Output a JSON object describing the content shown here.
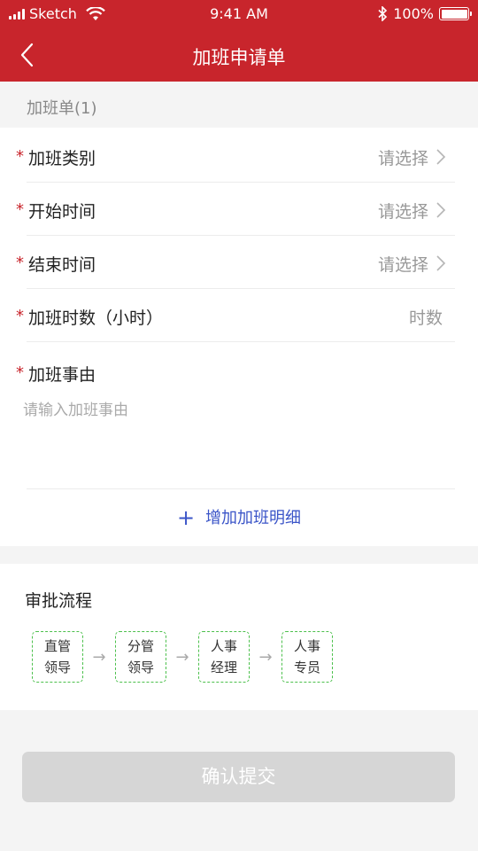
{
  "status_bar": {
    "carrier": "Sketch",
    "time": "9:41 AM",
    "battery": "100%"
  },
  "nav": {
    "title": "加班申请单",
    "back_icon": "chevron-left-icon"
  },
  "form": {
    "section_label": "加班单(1)",
    "fields": [
      {
        "label": "加班类别",
        "value": "请选择",
        "required": true,
        "type": "select"
      },
      {
        "label": "开始时间",
        "value": "请选择",
        "required": true,
        "type": "select"
      },
      {
        "label": "结束时间",
        "value": "请选择",
        "required": true,
        "type": "select"
      },
      {
        "label": "加班时数（小时）",
        "value": "时数",
        "required": true,
        "type": "input"
      }
    ],
    "reason": {
      "label": "加班事由",
      "placeholder": "请输入加班事由",
      "required": true
    },
    "add_detail": {
      "icon": "+",
      "label": "增加加班明细"
    },
    "required_mark": "*"
  },
  "approval": {
    "title": "审批流程",
    "steps": [
      {
        "line1": "直管",
        "line2": "领导"
      },
      {
        "line1": "分管",
        "line2": "领导"
      },
      {
        "line1": "人事",
        "line2": "经理"
      },
      {
        "line1": "人事",
        "line2": "专员"
      }
    ],
    "arrow": "→"
  },
  "submit": {
    "label": "确认提交"
  },
  "colors": {
    "brand_red": "#c8252c",
    "link_blue": "#3b55c8",
    "step_border_green": "#4cc04c",
    "button_disabled_gray": "#d6d6d6"
  }
}
